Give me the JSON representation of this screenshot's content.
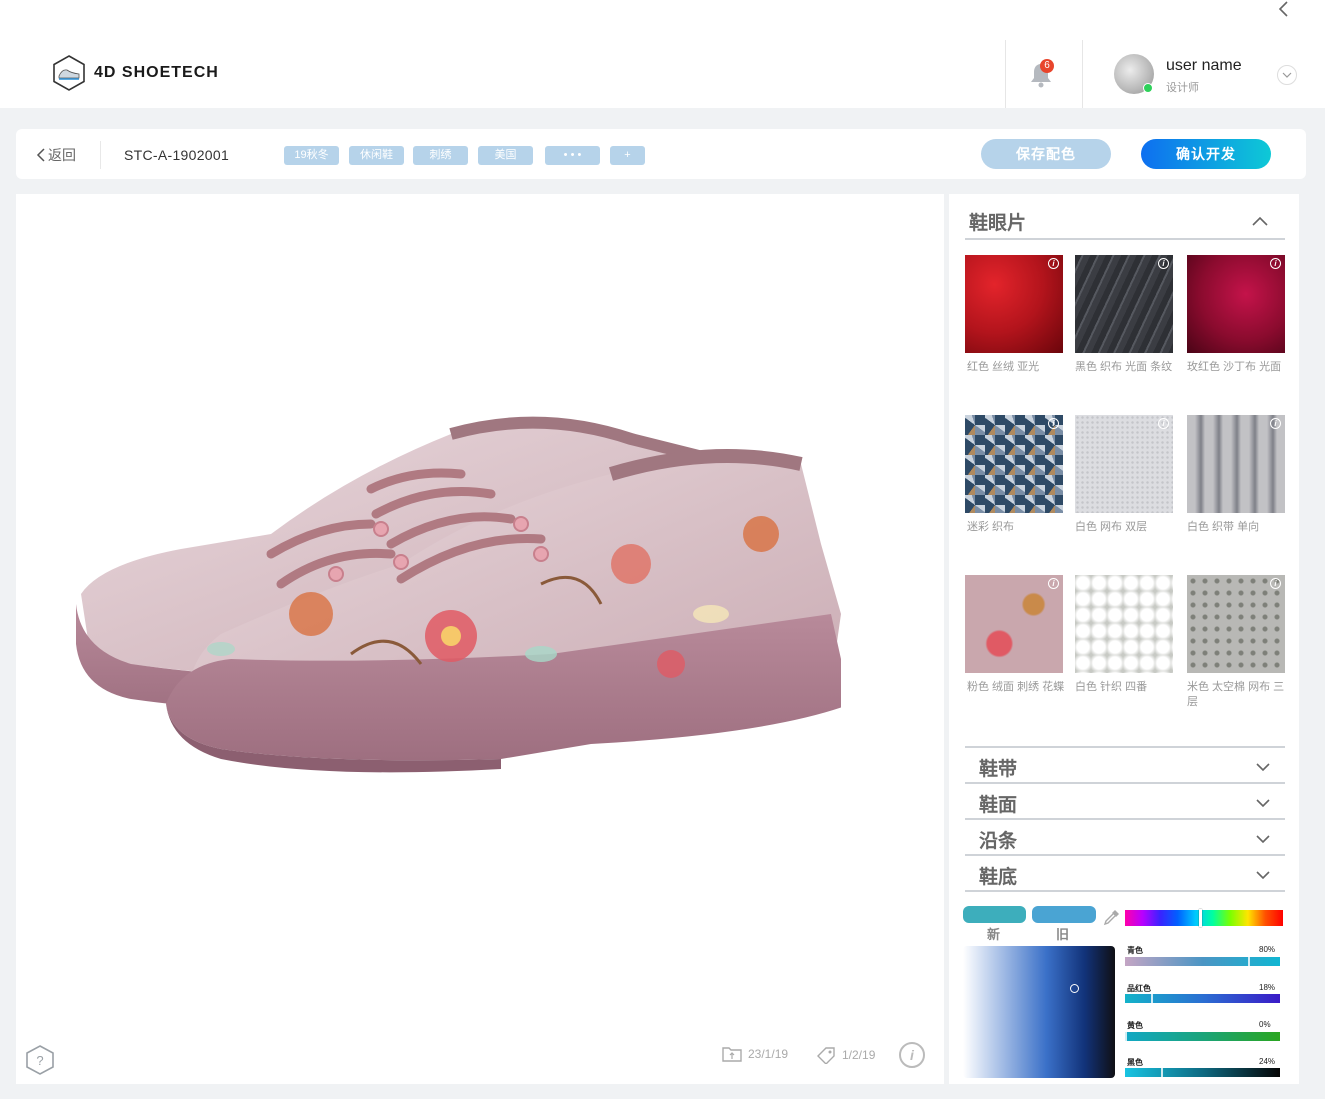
{
  "header": {
    "logo_text": "4D SHOETECH",
    "notification_count": "6",
    "user_name": "user name",
    "user_role": "设计师"
  },
  "toolbar": {
    "back_label": "返回",
    "product_code": "STC-A-1902001",
    "tags": [
      "19秋冬",
      "休闲鞋",
      "刺绣",
      "美国",
      "• • •",
      "+"
    ],
    "save_label": "保存配色",
    "confirm_label": "确认开发"
  },
  "viewer": {
    "date_created": "23/1/19",
    "date_tagged": "1/2/19"
  },
  "panel": {
    "section_title": "鞋眼片",
    "materials": [
      {
        "label": "红色  丝绒  亚光",
        "color": "#b3141c"
      },
      {
        "label": "黑色  织布  光面 条纹",
        "color": "#3b3d43"
      },
      {
        "label": "玫红色  沙丁布 光面",
        "color": "#8a0b2e"
      },
      {
        "label": "迷彩  织布",
        "color": "#3e5a78"
      },
      {
        "label": "白色  网布  双层",
        "color": "#d7d8dc"
      },
      {
        "label": "白色  织带  单向",
        "color": "#c8c8d0"
      },
      {
        "label": "粉色  绒面  刺绣 花蝶",
        "color": "#c9a7ad"
      },
      {
        "label": "白色  针织   四番",
        "color": "#f2f2f2"
      },
      {
        "label": "米色  太空棉  网布 三层",
        "color": "#b8b8b5"
      }
    ],
    "accordions": [
      "鞋带",
      "鞋面",
      "沿条",
      "鞋底"
    ],
    "color_picker": {
      "new_label": "新",
      "old_label": "旧",
      "new_color": "#3daebc",
      "old_color": "#4aa4d3",
      "channels": [
        {
          "name": "青色",
          "value": "80%"
        },
        {
          "name": "品红色",
          "value": "18%"
        },
        {
          "name": "黄色",
          "value": "0%"
        },
        {
          "name": "黑色",
          "value": "24%"
        }
      ]
    }
  }
}
